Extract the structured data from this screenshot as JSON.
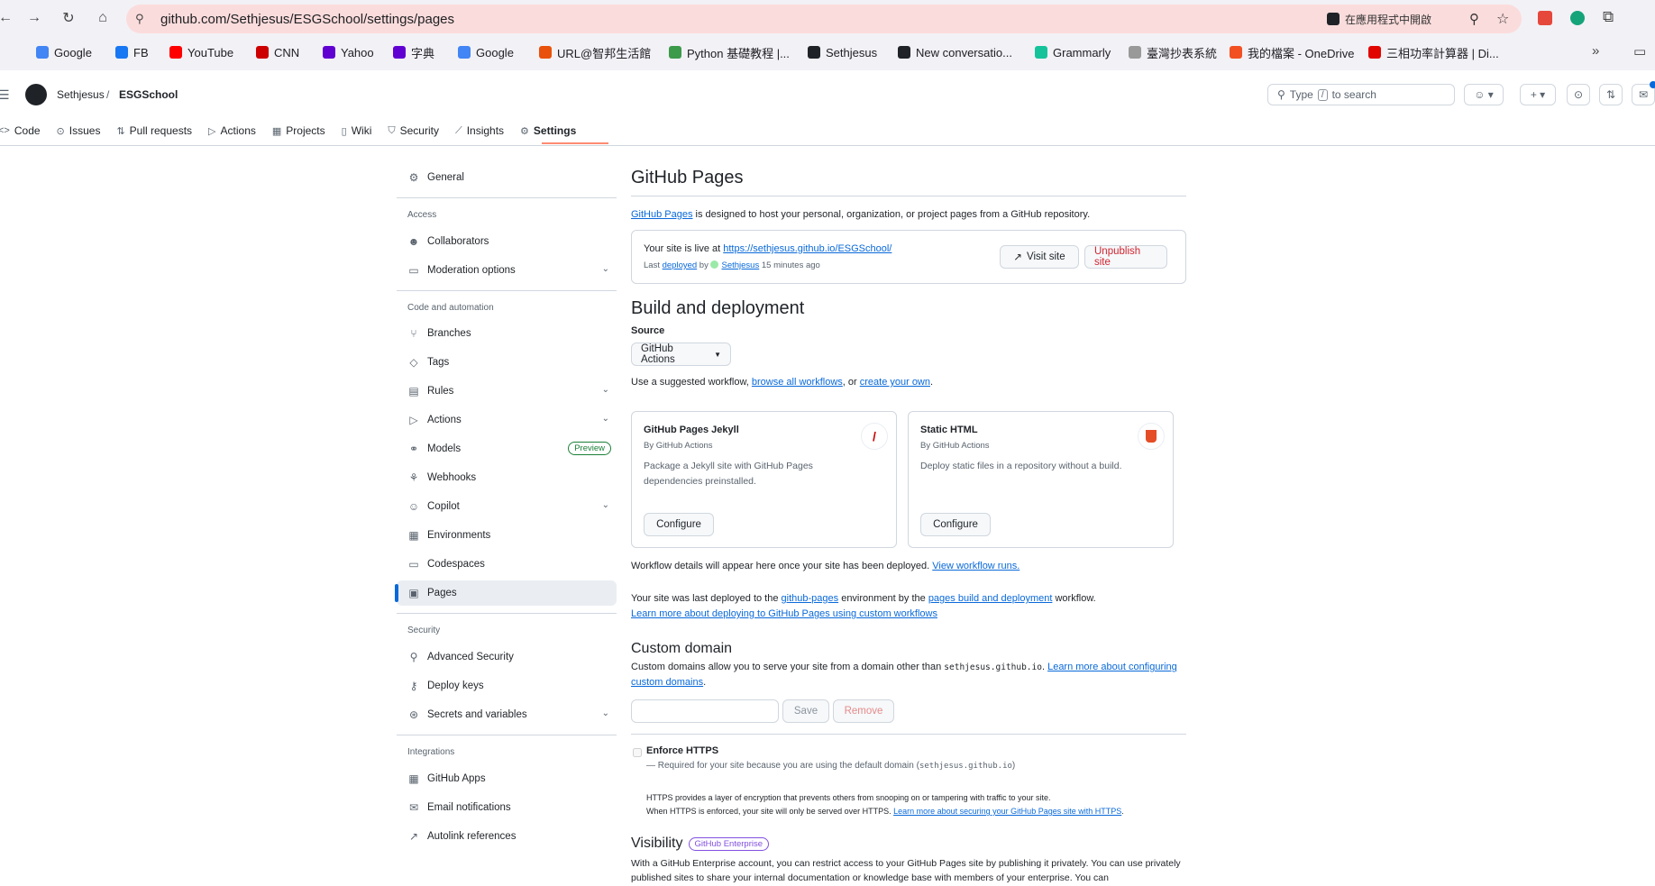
{
  "browser": {
    "url": "github.com/Sethjesus/ESGSchool/settings/pages",
    "open_in_app": "在應用程式中開啟",
    "bookmarks": [
      {
        "label": "Google",
        "color": "#4285f4"
      },
      {
        "label": "FB",
        "color": "#1877f2"
      },
      {
        "label": "YouTube",
        "color": "#ff0000"
      },
      {
        "label": "CNN",
        "color": "#cc0000"
      },
      {
        "label": "Yahoo",
        "color": "#6001d2"
      },
      {
        "label": "字典",
        "color": "#6001d2"
      },
      {
        "label": "Google",
        "color": "#4285f4"
      },
      {
        "label": "URL@智邦生活館",
        "color": "#e8520a"
      },
      {
        "label": "Python 基礎教程 |...",
        "color": "#3c9a4b"
      },
      {
        "label": "Sethjesus",
        "color": "#1f2328"
      },
      {
        "label": "New conversatio...",
        "color": "#1f2328"
      },
      {
        "label": "Grammarly",
        "color": "#15c39a"
      },
      {
        "label": "臺灣抄表系統",
        "color": "#999999"
      },
      {
        "label": "我的檔案 - OneDrive",
        "color": "#f25022"
      },
      {
        "label": "三相功率計算器 | Di...",
        "color": "#e10600"
      }
    ]
  },
  "header": {
    "owner": "Sethjesus",
    "separator": "/",
    "repo": "ESGSchool",
    "search_placeholder_pre": "Type",
    "search_key": "/",
    "search_placeholder_post": "to search"
  },
  "repo_nav": [
    {
      "label": "Code",
      "icon": "code-icon",
      "glyph": "<>"
    },
    {
      "label": "Issues",
      "icon": "issue-icon",
      "glyph": "⊙"
    },
    {
      "label": "Pull requests",
      "icon": "pull-request-icon",
      "glyph": "⇅"
    },
    {
      "label": "Actions",
      "icon": "play-icon",
      "glyph": "▷"
    },
    {
      "label": "Projects",
      "icon": "table-icon",
      "glyph": "▦"
    },
    {
      "label": "Wiki",
      "icon": "book-icon",
      "glyph": "▯"
    },
    {
      "label": "Security",
      "icon": "shield-icon",
      "glyph": "⛉"
    },
    {
      "label": "Insights",
      "icon": "graph-icon",
      "glyph": "⟋"
    },
    {
      "label": "Settings",
      "icon": "gear-icon",
      "glyph": "⚙"
    }
  ],
  "sidebar": {
    "general": "General",
    "access_heading": "Access",
    "collaborators": "Collaborators",
    "moderation": "Moderation options",
    "code_heading": "Code and automation",
    "branches": "Branches",
    "tags": "Tags",
    "rules": "Rules",
    "actions": "Actions",
    "models": "Models",
    "models_badge": "Preview",
    "webhooks": "Webhooks",
    "copilot": "Copilot",
    "environments": "Environments",
    "codespaces": "Codespaces",
    "pages": "Pages",
    "security_heading": "Security",
    "advanced_security": "Advanced Security",
    "deploy_keys": "Deploy keys",
    "secrets": "Secrets and variables",
    "integrations_heading": "Integrations",
    "github_apps": "GitHub Apps",
    "email_notifications": "Email notifications",
    "autolink": "Autolink references"
  },
  "main": {
    "title": "GitHub Pages",
    "intro_link": "GitHub Pages",
    "intro_rest": " is designed to host your personal, organization, or project pages from a GitHub repository.",
    "live_prefix": "Your site is live at ",
    "live_url": "https://sethjesus.github.io/ESGSchool/",
    "last_prefix": "Last ",
    "deployed_link": "deployed",
    "by": " by ",
    "deployer": "Sethjesus",
    "ago": " 15 minutes ago",
    "visit_site": "Visit site",
    "unpublish": "Unpublish site",
    "build_title": "Build and deployment",
    "source_label": "Source",
    "source_value": "GitHub Actions",
    "suggest_prefix": "Use a suggested workflow, ",
    "browse_link": "browse all workflows",
    "suggest_mid": ", or ",
    "create_link": "create your own",
    "suggest_end": ".",
    "cards": [
      {
        "title": "GitHub Pages Jekyll",
        "by": "By GitHub Actions",
        "desc": "Package a Jekyll site with GitHub Pages dependencies preinstalled.",
        "button": "Configure"
      },
      {
        "title": "Static HTML",
        "by": "By GitHub Actions",
        "desc": "Deploy static files in a repository without a build.",
        "button": "Configure"
      }
    ],
    "workflow_note": "Workflow details will appear here once your site has been deployed. ",
    "workflow_link": "View workflow runs.",
    "deployed_to_prefix": "Your site was last deployed to the ",
    "env_link": "github-pages",
    "deployed_mid": " environment by the ",
    "workflow_name_link": "pages build and deployment",
    "deployed_end": " workflow.",
    "learn_custom_link": "Learn more about deploying to GitHub Pages using custom workflows",
    "custom_domain_title": "Custom domain",
    "custom_domain_text": "Custom domains allow you to serve your site from a domain other than ",
    "default_domain": "sethjesus.github.io",
    "custom_domain_dot": ". ",
    "custom_learn_link": "Learn more about configuring custom domains",
    "custom_domain_end": ".",
    "domain_value": "",
    "save": "Save",
    "remove": "Remove",
    "https_label": "Enforce HTTPS",
    "https_required_pre": "— Required for your site because you are using the default domain (",
    "https_required_domain": "sethjesus.github.io",
    "https_required_end": ")",
    "https_desc1": "HTTPS provides a layer of encryption that prevents others from snooping on or tampering with traffic to your site.",
    "https_desc2": "When HTTPS is enforced, your site will only be served over HTTPS. ",
    "https_learn_link": "Learn more about securing your GitHub Pages site with HTTPS",
    "https_learn_end": ".",
    "visibility_title": "Visibility",
    "visibility_badge": "GitHub Enterprise",
    "visibility_text": "With a GitHub Enterprise account, you can restrict access to your GitHub Pages site by publishing it privately. You can use privately published sites to share your internal documentation or knowledge base with members of your enterprise. You can"
  }
}
